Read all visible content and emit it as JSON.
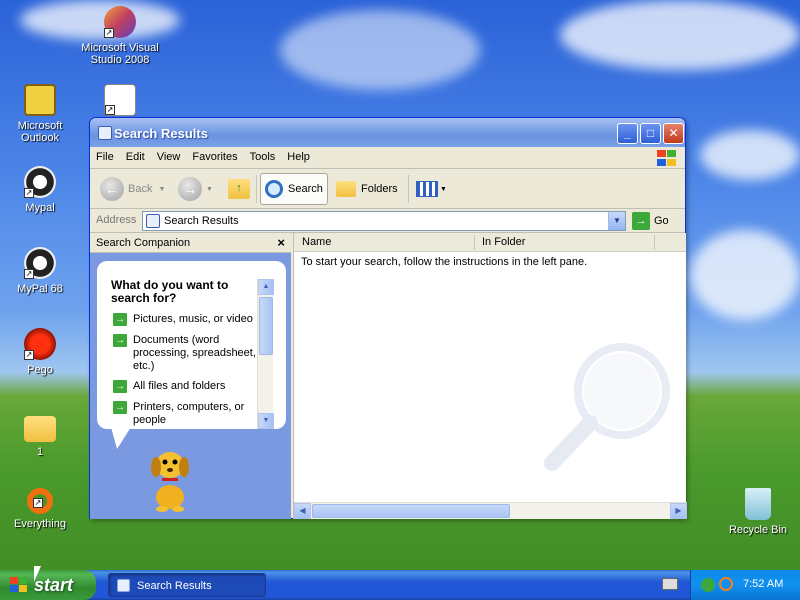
{
  "desktop": {
    "icons": [
      {
        "label": "Microsoft Visual Studio 2008",
        "icon": "visual-studio-icon"
      },
      {
        "label": "Microsoft Outlook",
        "icon": "outlook-icon"
      },
      {
        "label": "",
        "icon": "document-chart-icon"
      },
      {
        "label": "Mypal",
        "icon": "mypal-icon"
      },
      {
        "label": "MyPal 68",
        "icon": "mypal68-icon"
      },
      {
        "label": "Pego",
        "icon": "pego-icon"
      },
      {
        "label": "1",
        "icon": "folder-icon"
      },
      {
        "label": "Everything",
        "icon": "everything-icon"
      },
      {
        "label": "Recycle Bin",
        "icon": "recycle-bin-icon"
      }
    ]
  },
  "window": {
    "title": "Search Results",
    "menu": [
      "File",
      "Edit",
      "View",
      "Favorites",
      "Tools",
      "Help"
    ],
    "toolbar": {
      "back": "Back",
      "search": "Search",
      "folders": "Folders"
    },
    "address": {
      "label": "Address",
      "value": "Search Results",
      "go": "Go"
    },
    "left_pane": {
      "header": "Search Companion",
      "close": "×",
      "question": "What do you want to search for?",
      "options": [
        "Pictures, music, or video",
        "Documents (word processing, spreadsheet, etc.)",
        "All files and folders",
        "Printers, computers, or people"
      ]
    },
    "right_pane": {
      "columns": [
        "Name",
        "In Folder"
      ],
      "hint": "To start your search, follow the instructions in the left pane."
    }
  },
  "taskbar": {
    "start": "start",
    "task": "Search Results",
    "clock": "7:52 AM"
  },
  "colors": {
    "titlebar": "#7da2e8",
    "taskbar": "#2157d7",
    "start": "#3a9a3a",
    "companion": "#7b99e1"
  }
}
